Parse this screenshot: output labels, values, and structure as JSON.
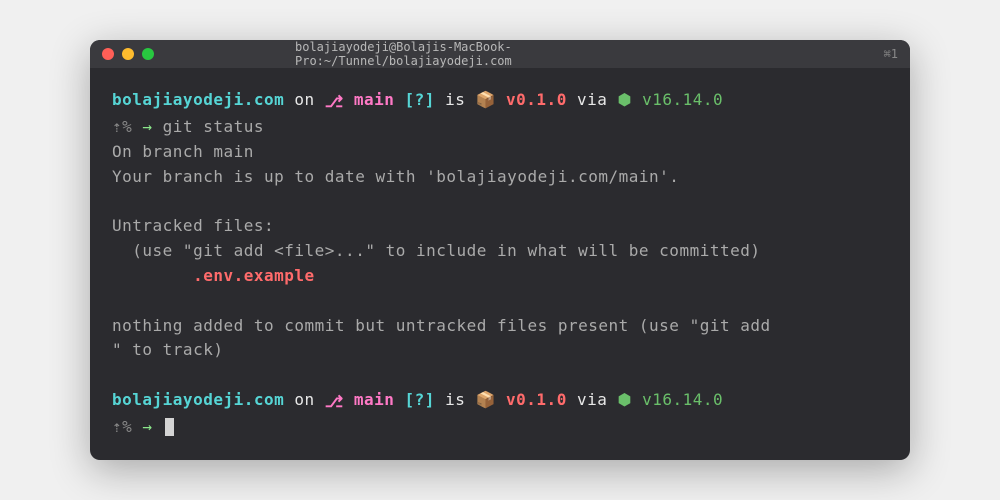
{
  "titlebar": {
    "title": "bolajiayodeji@Bolajis-MacBook-Pro:~/Tunnel/bolajiayodeji.com",
    "shortcut": "⌘1"
  },
  "prompt": {
    "dir": "bolajiayodeji.com",
    "on": " on ",
    "branch_icon": "⎇",
    "branch": " main ",
    "status": "[?]",
    "is": " is ",
    "pkg_icon": "📦",
    "version": " v0.1.0",
    "via": " via ",
    "hex_icon": "⬢",
    "node_version": " v16.14.0",
    "line2_prefix": "⇡%",
    "arrow": " → ",
    "command": "git status"
  },
  "output": {
    "l1": "On branch main",
    "l2": "Your branch is up to date with 'bolajiayodeji.com/main'.",
    "l3": "Untracked files:",
    "l4": "  (use \"git add <file>...\" to include in what will be committed)",
    "l5": "        .env.example",
    "l6": "nothing added to commit but untracked files present (use \"git add",
    "l7": "\" to track)"
  }
}
